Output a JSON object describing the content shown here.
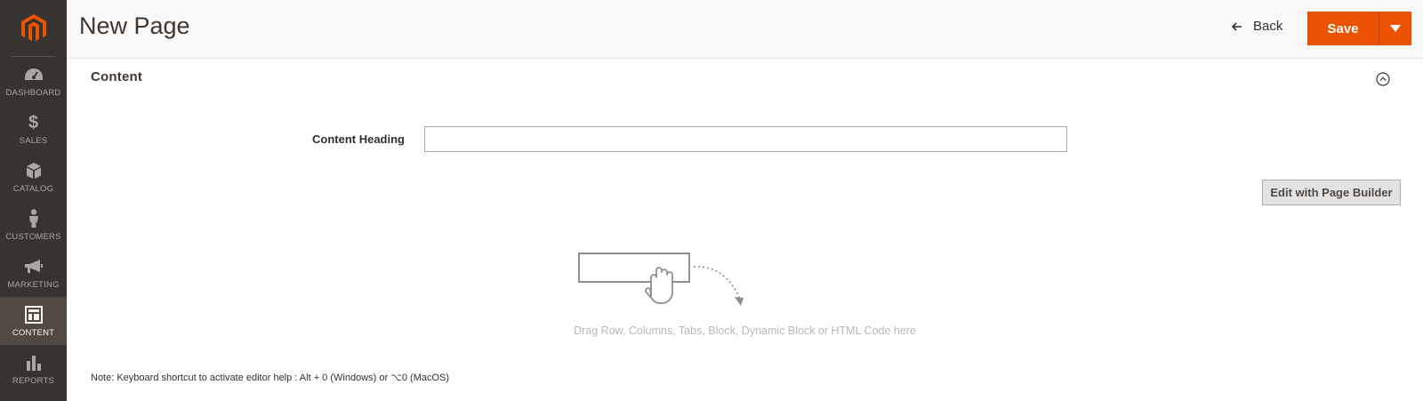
{
  "sidebar": {
    "items": [
      {
        "label": "DASHBOARD",
        "icon": "dashboard-icon",
        "active": false
      },
      {
        "label": "SALES",
        "icon": "dollar-icon",
        "active": false
      },
      {
        "label": "CATALOG",
        "icon": "cube-icon",
        "active": false
      },
      {
        "label": "CUSTOMERS",
        "icon": "person-icon",
        "active": false
      },
      {
        "label": "MARKETING",
        "icon": "megaphone-icon",
        "active": false
      },
      {
        "label": "CONTENT",
        "icon": "layout-icon",
        "active": true
      },
      {
        "label": "REPORTS",
        "icon": "bar-chart-icon",
        "active": false
      }
    ],
    "dollar_symbol": "$"
  },
  "header": {
    "title": "New Page",
    "back_label": "Back",
    "save_label": "Save"
  },
  "content": {
    "section_title": "Content",
    "heading_label": "Content Heading",
    "heading_value": "",
    "page_builder_button": "Edit with Page Builder",
    "drop_hint": "Drag Row, Columns, Tabs, Block, Dynamic Block or HTML Code here",
    "note": "Note: Keyboard shortcut to activate editor help : Alt + 0 (Windows) or ⌥0 (MacOS)"
  },
  "colors": {
    "sidebar_bg": "#373330",
    "sidebar_active": "#514943",
    "brand_orange": "#eb5202"
  }
}
